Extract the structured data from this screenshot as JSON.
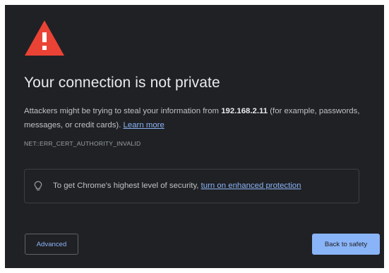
{
  "warning": {
    "icon": "warning-icon",
    "color": "#ea4335"
  },
  "title": "Your connection is not private",
  "message": {
    "part1": "Attackers might be trying to steal your information from ",
    "host": "192.168.2.11",
    "part2": " (for example, passwords, messages, or credit cards). ",
    "learn_more": "Learn more"
  },
  "error_code": "NET::ERR_CERT_AUTHORITY_INVALID",
  "security": {
    "icon": "lightbulb-icon",
    "text": "To get Chrome's highest level of security, ",
    "link": "turn on enhanced protection"
  },
  "buttons": {
    "advanced": "Advanced",
    "back_to_safety": "Back to safety"
  },
  "colors": {
    "background": "#202124",
    "link": "#8ab4f8",
    "primary_button": "#8ab4f8",
    "warning": "#ea4335"
  }
}
